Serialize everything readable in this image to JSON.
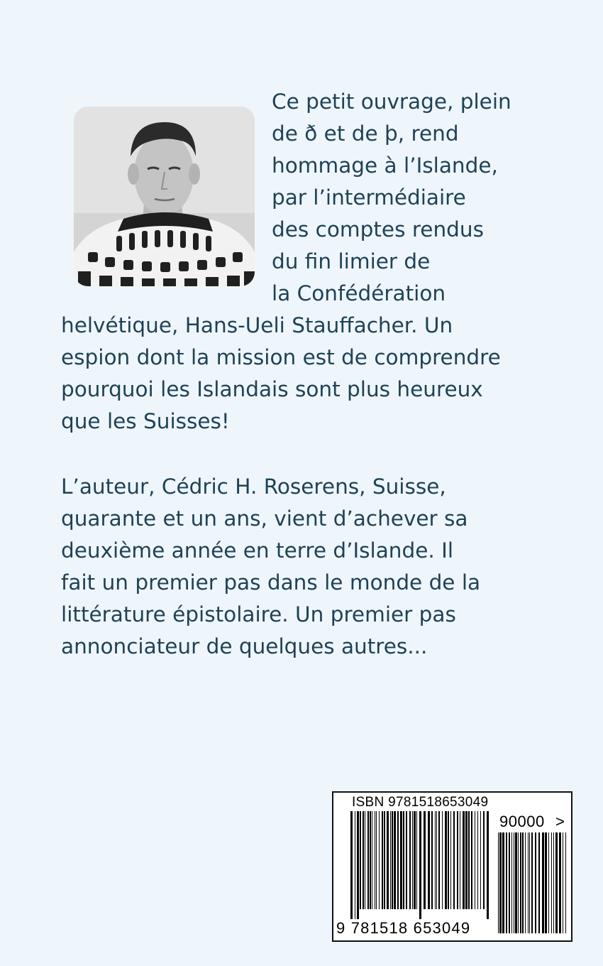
{
  "blurb": {
    "right_lines": [
      "Ce petit ouvrage, plein",
      "de ð et de þ, rend",
      "hommage à l’Islande,",
      "par l’intermédiaire",
      "des comptes rendus",
      "du fin limier de",
      "la Confédération"
    ],
    "full_lines": [
      "helvétique, Hans-Ueli Stauffacher. Un",
      "espion dont la mission est de comprendre",
      "pourquoi les Islandais sont plus heureux",
      "que les Suisses!"
    ]
  },
  "bio": {
    "lines": [
      "L’auteur, Cédric H. Roserens, Suisse,",
      "quarante et un ans, vient d’achever sa",
      "deuxième année en terre d’Islande. Il",
      "fait un premier pas dans le monde de la",
      "littérature épistolaire. Un premier pas",
      "annonciateur de quelques autres..."
    ]
  },
  "barcode": {
    "isbn_label": "ISBN 9781518653049",
    "price_code": "90000",
    "price_arrow": ">",
    "digits": "9 781518 653049"
  },
  "colors": {
    "background": "#eef6fb",
    "text": "#1f4257"
  }
}
